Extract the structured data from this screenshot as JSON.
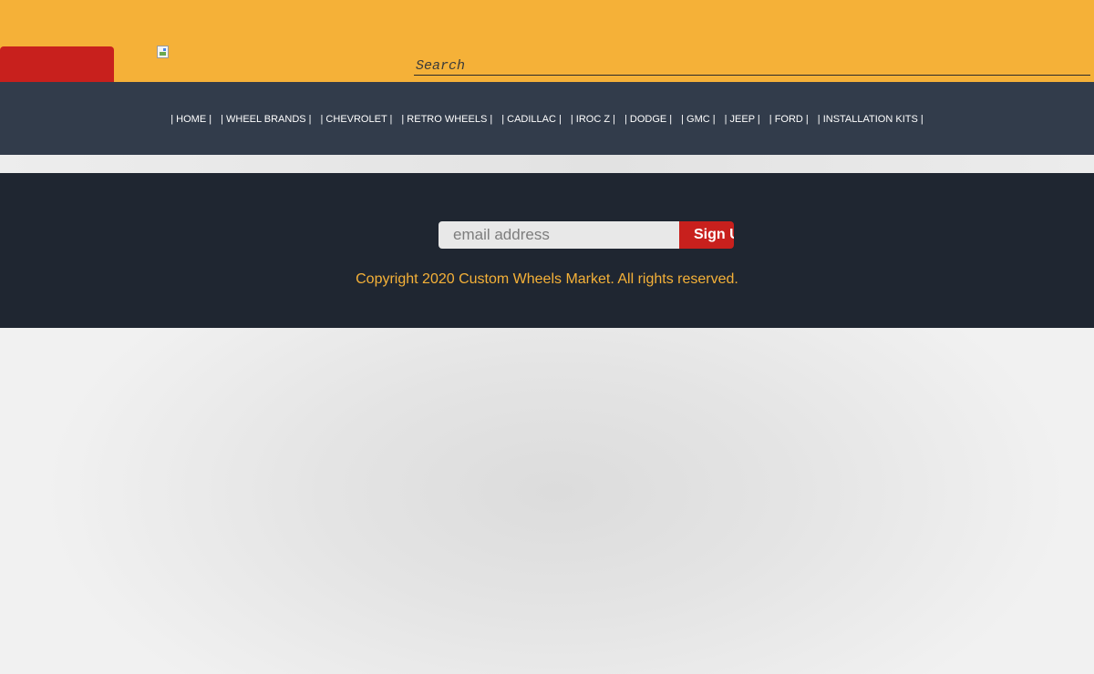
{
  "header": {
    "search_placeholder": "Search",
    "logo_icon": "broken-image-icon"
  },
  "nav": {
    "items": [
      {
        "label": "| HOME |"
      },
      {
        "label": "| WHEEL BRANDS |"
      },
      {
        "label": "| CHEVROLET |"
      },
      {
        "label": "| RETRO WHEELS |"
      },
      {
        "label": "| CADILLAC |"
      },
      {
        "label": "| IROC Z |"
      },
      {
        "label": "| DODGE |"
      },
      {
        "label": "| GMC |"
      },
      {
        "label": "| JEEP |"
      },
      {
        "label": "| FORD |"
      },
      {
        "label": "| INSTALLATION KITS |"
      }
    ]
  },
  "footer": {
    "email_placeholder": "email address",
    "signup_label": "Sign Up",
    "copyright": "Copyright 2020 Custom Wheels Market. All rights reserved."
  },
  "colors": {
    "header_bg": "#f5b138",
    "accent_red": "#c8201d",
    "nav_bg": "#323c4b",
    "footer_bg": "#1f2631",
    "copyright_text": "#f5b138"
  }
}
